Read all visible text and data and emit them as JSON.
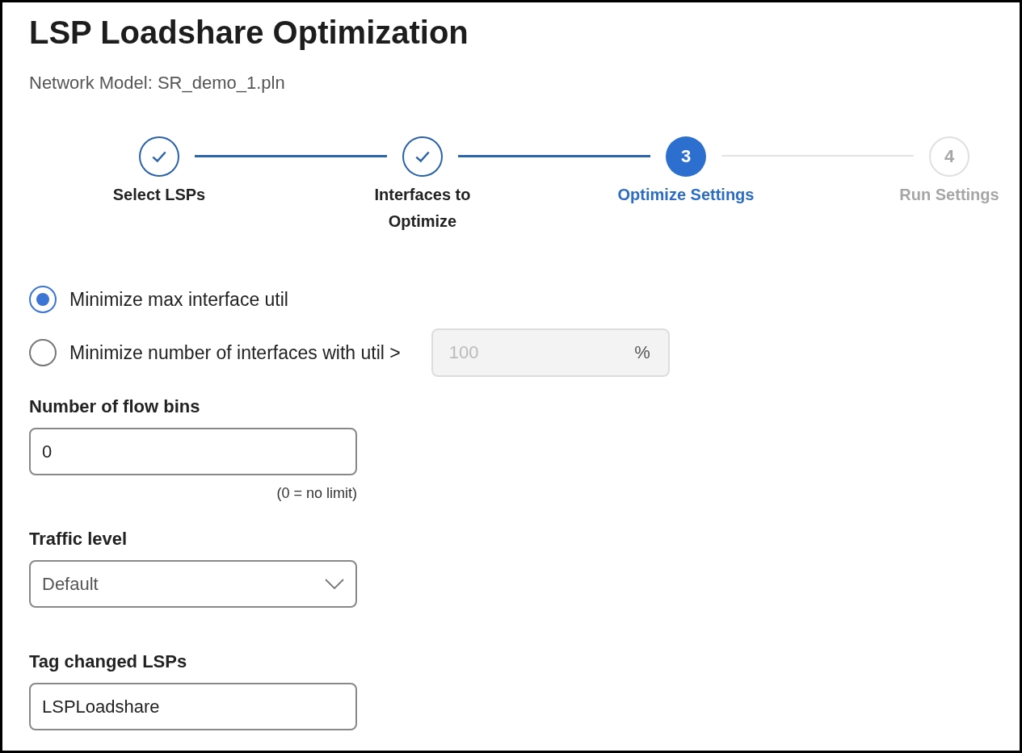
{
  "title": "LSP Loadshare Optimization",
  "subtitle": "Network Model: SR_demo_1.pln",
  "steps": [
    {
      "label": "Select LSPs",
      "completed": true,
      "selected": false
    },
    {
      "label": "Interfaces to Optimize",
      "completed": true,
      "selected": false
    },
    {
      "label": "Optimize Settings",
      "number": "3",
      "completed": false,
      "selected": true
    },
    {
      "label": "Run Settings",
      "number": "4",
      "completed": false,
      "selected": false
    }
  ],
  "objective": [
    {
      "label": "Minimize max interface util",
      "selected": true
    },
    {
      "label": "Minimize number of interfaces with util >",
      "selected": false,
      "threshold": {
        "value": "100",
        "unit": "%",
        "disabled": true
      }
    }
  ],
  "flow_bins": {
    "label": "Number of flow bins",
    "value": "0",
    "hint": "(0 = no limit)"
  },
  "traffic_level": {
    "label": "Traffic level",
    "value": "Default"
  },
  "tag": {
    "label": "Tag changed LSPs",
    "value": "LSPLoadshare"
  }
}
